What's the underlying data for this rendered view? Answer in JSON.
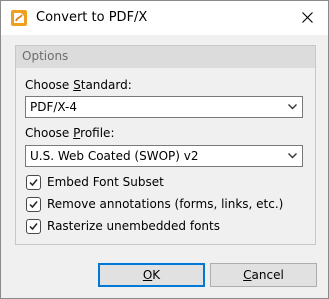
{
  "window": {
    "title": "Convert to PDF/X"
  },
  "options": {
    "group_title": "Options",
    "standard_label_pre": "Choose ",
    "standard_label_u": "S",
    "standard_label_post": "tandard:",
    "standard_value": "PDF/X-4",
    "profile_label_pre": "Choose ",
    "profile_label_u": "P",
    "profile_label_post": "rofile:",
    "profile_value": "U.S. Web Coated (SWOP) v2",
    "checkboxes": [
      {
        "label": "Embed Font Subset",
        "checked": true
      },
      {
        "label": "Remove annotations (forms, links, etc.)",
        "checked": true
      },
      {
        "label": "Rasterize unembedded fonts",
        "checked": true
      }
    ]
  },
  "buttons": {
    "ok_u": "O",
    "ok_rest": "K",
    "cancel_u": "C",
    "cancel_rest": "ancel"
  },
  "colors": {
    "accent": "#0078d7",
    "icon_orange": "#f0a020"
  },
  "icons": [
    "app-logo-icon",
    "close-icon",
    "chevron-down-icon",
    "checkmark-icon"
  ]
}
